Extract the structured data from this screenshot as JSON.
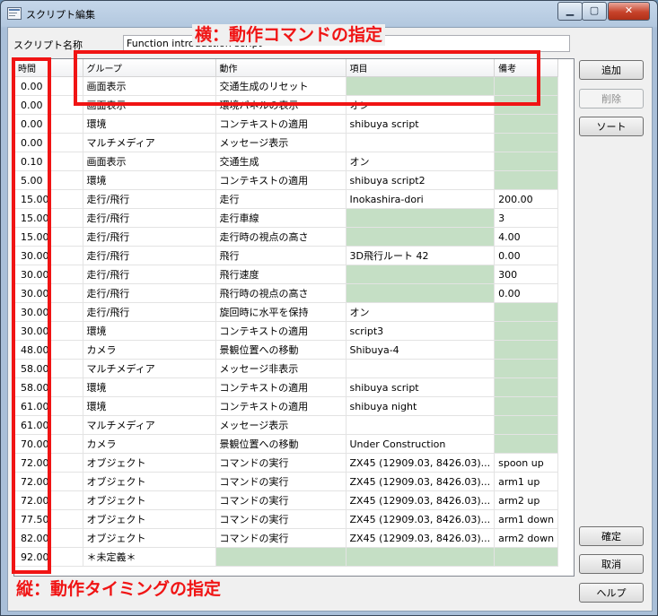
{
  "window": {
    "title": "スクリプト編集",
    "min_label": "▁",
    "max_label": "▢",
    "close_label": "✕"
  },
  "script_name": {
    "label": "スクリプト名称",
    "value": "Function introduction script"
  },
  "table": {
    "headers": [
      "時間",
      "グループ",
      "動作",
      "項目",
      "備考"
    ],
    "rows": [
      [
        "0.00",
        "画面表示",
        "交通生成のリセット",
        "",
        ""
      ],
      [
        "0.00",
        "画面表示",
        "環境パネルの表示",
        "オン",
        ""
      ],
      [
        "0.00",
        "環境",
        "コンテキストの適用",
        "shibuya script",
        ""
      ],
      [
        "0.00",
        "マルチメディア",
        "メッセージ表示",
        "",
        ""
      ],
      [
        "0.10",
        "画面表示",
        "交通生成",
        "オン",
        ""
      ],
      [
        "5.00",
        "環境",
        "コンテキストの適用",
        "shibuya script2",
        ""
      ],
      [
        "15.00",
        "走行/飛行",
        "走行",
        "Inokashira-dori",
        "200.00"
      ],
      [
        "15.00",
        "走行/飛行",
        "走行車線",
        "",
        "3"
      ],
      [
        "15.00",
        "走行/飛行",
        "走行時の視点の高さ",
        "",
        "4.00"
      ],
      [
        "30.00",
        "走行/飛行",
        "飛行",
        "3D飛行ルート 42",
        "0.00"
      ],
      [
        "30.00",
        "走行/飛行",
        "飛行速度",
        "",
        "300"
      ],
      [
        "30.00",
        "走行/飛行",
        "飛行時の視点の高さ",
        "",
        "0.00"
      ],
      [
        "30.00",
        "走行/飛行",
        "旋回時に水平を保持",
        "オン",
        ""
      ],
      [
        "30.00",
        "環境",
        "コンテキストの適用",
        "script3",
        ""
      ],
      [
        "48.00",
        "カメラ",
        "景観位置への移動",
        "Shibuya-4",
        ""
      ],
      [
        "58.00",
        "マルチメディア",
        "メッセージ非表示",
        "",
        ""
      ],
      [
        "58.00",
        "環境",
        "コンテキストの適用",
        "shibuya script",
        ""
      ],
      [
        "61.00",
        "環境",
        "コンテキストの適用",
        "shibuya night",
        ""
      ],
      [
        "61.00",
        "マルチメディア",
        "メッセージ表示",
        "",
        ""
      ],
      [
        "70.00",
        "カメラ",
        "景観位置への移動",
        "Under Construction",
        ""
      ],
      [
        "72.00",
        "オブジェクト",
        "コマンドの実行",
        "ZX45 (12909.03, 8426.03)...",
        "spoon up"
      ],
      [
        "72.00",
        "オブジェクト",
        "コマンドの実行",
        "ZX45 (12909.03, 8426.03)...",
        "arm1 up"
      ],
      [
        "72.00",
        "オブジェクト",
        "コマンドの実行",
        "ZX45 (12909.03, 8426.03)...",
        "arm2 up"
      ],
      [
        "77.50",
        "オブジェクト",
        "コマンドの実行",
        "ZX45 (12909.03, 8426.03)...",
        "arm1 down"
      ],
      [
        "82.00",
        "オブジェクト",
        "コマンドの実行",
        "ZX45 (12909.03, 8426.03)...",
        "arm2 down"
      ],
      [
        "92.00",
        "＊未定義＊",
        "",
        "",
        ""
      ]
    ],
    "empty_cells": [
      [
        0,
        3
      ],
      [
        0,
        4
      ],
      [
        1,
        4
      ],
      [
        2,
        4
      ],
      [
        3,
        4
      ],
      [
        4,
        4
      ],
      [
        5,
        4
      ],
      [
        7,
        3
      ],
      [
        8,
        3
      ],
      [
        10,
        3
      ],
      [
        11,
        3
      ],
      [
        12,
        4
      ],
      [
        13,
        4
      ],
      [
        14,
        4
      ],
      [
        15,
        4
      ],
      [
        16,
        4
      ],
      [
        17,
        4
      ],
      [
        18,
        4
      ],
      [
        19,
        4
      ],
      [
        25,
        2
      ],
      [
        25,
        3
      ],
      [
        25,
        4
      ]
    ]
  },
  "buttons": {
    "add": "追加",
    "delete": "削除",
    "sort": "ソート",
    "ok": "確定",
    "cancel": "取消",
    "help": "ヘルプ"
  },
  "annotations": {
    "horizontal": "横：動作コマンドの指定",
    "vertical": "縦：動作タイミングの指定",
    "color": "#f01414"
  },
  "colors": {
    "empty_cell": "#c5dfc5",
    "window_frame": "#b3c8df"
  }
}
